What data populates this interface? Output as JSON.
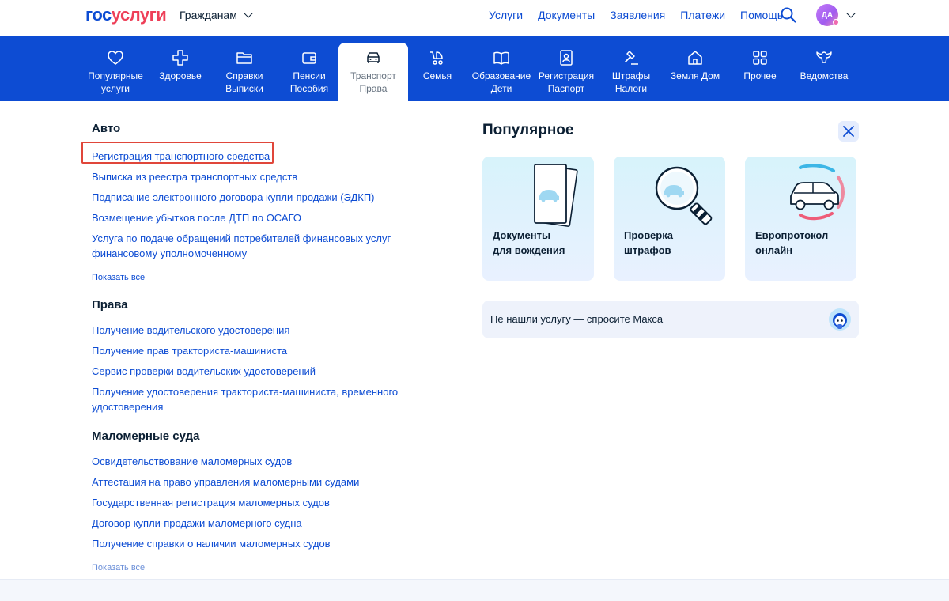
{
  "header": {
    "logo_part1": "гос",
    "logo_part2": "услуги",
    "audience": "Гражданам",
    "nav": [
      "Услуги",
      "Документы",
      "Заявления",
      "Платежи",
      "Помощь"
    ],
    "avatar_initials": "ДА"
  },
  "categories": [
    {
      "line1": "Популярные",
      "line2": "услуги",
      "icon": "heart-icon"
    },
    {
      "line1": "Здоровье",
      "line2": "",
      "icon": "health-cross-icon"
    },
    {
      "line1": "Справки",
      "line2": "Выписки",
      "icon": "folder-icon"
    },
    {
      "line1": "Пенсии",
      "line2": "Пособия",
      "icon": "wallet-icon"
    },
    {
      "line1": "Транспорт",
      "line2": "Права",
      "icon": "car-icon"
    },
    {
      "line1": "Семья",
      "line2": "",
      "icon": "stroller-icon"
    },
    {
      "line1": "Образование",
      "line2": "Дети",
      "icon": "book-icon"
    },
    {
      "line1": "Регистрация",
      "line2": "Паспорт",
      "icon": "passport-icon"
    },
    {
      "line1": "Штрафы",
      "line2": "Налоги",
      "icon": "gavel-icon"
    },
    {
      "line1": "Земля Дом",
      "line2": "",
      "icon": "house-icon"
    },
    {
      "line1": "Прочее",
      "line2": "",
      "icon": "grid-icon"
    },
    {
      "line1": "Ведомства",
      "line2": "",
      "icon": "emblem-icon"
    }
  ],
  "sections": {
    "auto": {
      "title": "Авто",
      "links": [
        "Регистрация транспортного средства",
        "Выписка из реестра транспортных средств",
        "Подписание электронного договора купли-продажи (ЭДКП)",
        "Возмещение убытков после ДТП по ОСАГО"
      ],
      "link_multiline_1": "Услуга по подаче обращений потребителей финансовых услуг",
      "link_multiline_2": "финансовому уполномоченному",
      "show_all": "Показать все"
    },
    "rights": {
      "title": "Права",
      "links": [
        "Получение водительского удостоверения",
        "Получение прав тракториста-машиниста",
        "Сервис проверки водительских удостоверений"
      ],
      "link_multiline_1": "Получение удостоверения тракториста-машиниста, временного",
      "link_multiline_2": "удостоверения"
    },
    "boats": {
      "title": "Маломерные суда",
      "links": [
        "Освидетельствование маломерных судов",
        "Аттестация на право управления маломерными судами",
        "Государственная регистрация маломерных судов",
        "Договор купли-продажи маломерного судна",
        "Получение справки о наличии маломерных судов"
      ],
      "show_all": "Показать все"
    }
  },
  "popular": {
    "title": "Популярное",
    "cards": [
      {
        "line1": "Документы",
        "line2": "для вождения",
        "icon": "documents-icon"
      },
      {
        "line1": "Проверка",
        "line2": "штрафов",
        "icon": "magnifier-icon"
      },
      {
        "line1": "Европротокол",
        "line2": "онлайн",
        "icon": "car-outline-icon"
      }
    ],
    "ask": "Не нашли услугу — спросите Макса"
  },
  "colors": {
    "brand_blue": "#0d4cd3",
    "brand_red": "#ee3f58",
    "highlight_red": "#e0463a"
  }
}
